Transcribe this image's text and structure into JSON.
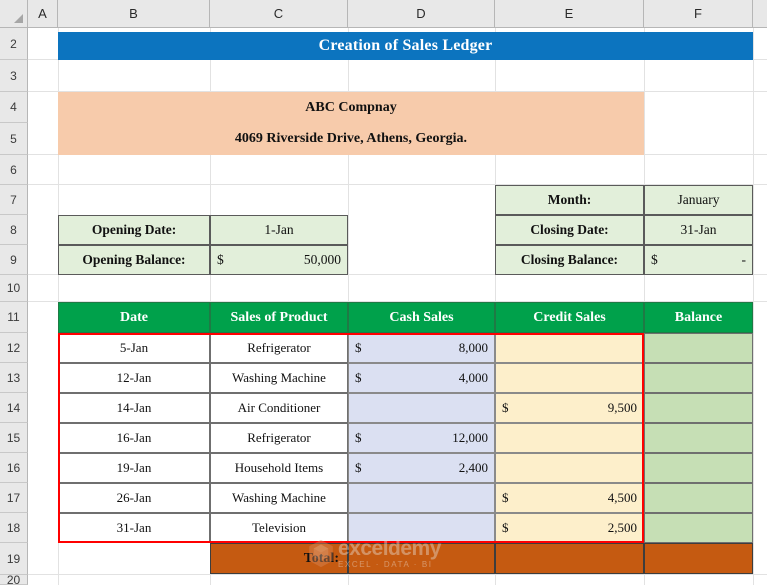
{
  "app": {
    "type": "spreadsheet",
    "colors": {
      "title_band": "#0C74BF",
      "company_band": "#F7CBAB",
      "info_fill": "#E2EFDA",
      "header_green": "#00A14B",
      "cash_fill": "#DBE0F2",
      "credit_fill": "#FDEFCB",
      "balance_fill": "#C6DFB5",
      "total_fill": "#C55A11",
      "selection_border": "#FF0000"
    }
  },
  "grid": {
    "column_headers": [
      "A",
      "B",
      "C",
      "D",
      "E",
      "F"
    ],
    "row_headers": [
      "2",
      "3",
      "4",
      "5",
      "6",
      "7",
      "8",
      "9",
      "10",
      "11",
      "12",
      "13",
      "14",
      "15",
      "16",
      "17",
      "18",
      "19",
      "20"
    ]
  },
  "title": {
    "text": "Creation of Sales Ledger"
  },
  "company": {
    "name": "ABC Compnay",
    "address": "4069 Riverside Drive, Athens, Georgia."
  },
  "opening": {
    "date_label": "Opening Date:",
    "date_value": "1-Jan",
    "balance_label": "Opening Balance:",
    "balance_currency": "$",
    "balance_value": "50,000"
  },
  "closing": {
    "month_label": "Month:",
    "month_value": "January",
    "date_label": "Closing Date:",
    "date_value": "31-Jan",
    "balance_label": "Closing Balance:",
    "balance_currency": "$",
    "balance_value": "-"
  },
  "ledger": {
    "headers": [
      "Date",
      "Sales of Product",
      "Cash Sales",
      "Credit Sales",
      "Balance"
    ],
    "rows": [
      {
        "date": "5-Jan",
        "product": "Refrigerator",
        "cash_currency": "$",
        "cash": "8,000",
        "credit_currency": "",
        "credit": "",
        "balance": ""
      },
      {
        "date": "12-Jan",
        "product": "Washing Machine",
        "cash_currency": "$",
        "cash": "4,000",
        "credit_currency": "",
        "credit": "",
        "balance": ""
      },
      {
        "date": "14-Jan",
        "product": "Air Conditioner",
        "cash_currency": "",
        "cash": "",
        "credit_currency": "$",
        "credit": "9,500",
        "balance": ""
      },
      {
        "date": "16-Jan",
        "product": "Refrigerator",
        "cash_currency": "$",
        "cash": "12,000",
        "credit_currency": "",
        "credit": "",
        "balance": ""
      },
      {
        "date": "19-Jan",
        "product": "Household Items",
        "cash_currency": "$",
        "cash": "2,400",
        "credit_currency": "",
        "credit": "",
        "balance": ""
      },
      {
        "date": "26-Jan",
        "product": "Washing Machine",
        "cash_currency": "",
        "cash": "",
        "credit_currency": "$",
        "credit": "4,500",
        "balance": ""
      },
      {
        "date": "31-Jan",
        "product": "Television",
        "cash_currency": "",
        "cash": "",
        "credit_currency": "$",
        "credit": "2,500",
        "balance": ""
      }
    ],
    "total_label": "Total:",
    "total_cash": "",
    "total_credit": "",
    "total_balance": ""
  },
  "watermark": {
    "main": "exceldemy",
    "sub": "EXCEL · DATA · BI"
  }
}
